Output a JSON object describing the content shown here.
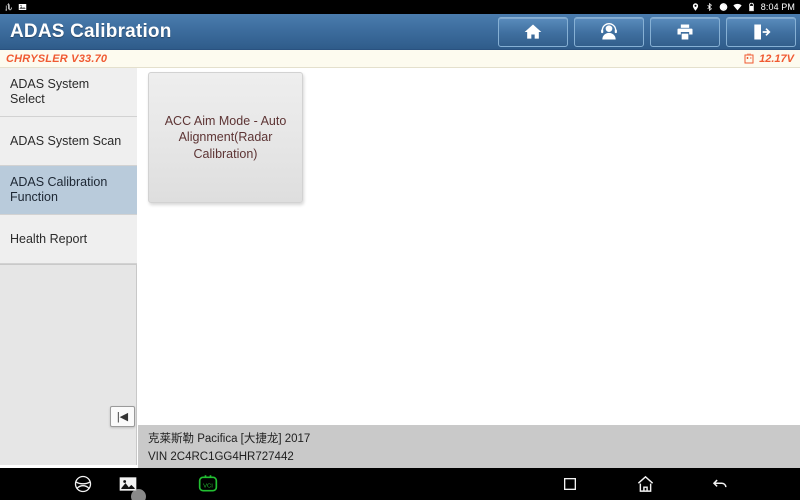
{
  "statusbar": {
    "left_icons": [
      "usb-icon",
      "screenshot-icon"
    ],
    "right_icons": [
      "location-icon",
      "bluetooth-icon",
      "sync-icon",
      "wifi-icon",
      "battery-icon"
    ],
    "time": "8:04 PM"
  },
  "titlebar": {
    "title": "ADAS Calibration",
    "actions": [
      {
        "name": "home-button",
        "icon": "home-icon"
      },
      {
        "name": "support-button",
        "icon": "headset-person-icon"
      },
      {
        "name": "print-button",
        "icon": "printer-icon"
      },
      {
        "name": "exit-button",
        "icon": "exit-door-icon"
      }
    ]
  },
  "versionbar": {
    "version": "CHRYSLER V33.70",
    "voltage": "12.17V",
    "accent_color": "#f05a32"
  },
  "sidebar": {
    "items": [
      {
        "label": "ADAS System Select",
        "active": false
      },
      {
        "label": "ADAS System Scan",
        "active": false
      },
      {
        "label": "ADAS Calibration Function",
        "active": true
      },
      {
        "label": "Health Report",
        "active": false
      }
    ],
    "collapse_glyph": "|◀",
    "active_color": "#b9cbdb"
  },
  "main": {
    "tiles": [
      {
        "label": "ACC Aim Mode - Auto Alignment(Radar Calibration)"
      }
    ],
    "tile_text_color": "#5d3434"
  },
  "vehicle": {
    "model": "克莱斯勒 Pacifica [大捷龙] 2017",
    "vin": "VIN 2C4RC1GG4HR727442"
  },
  "navbar": {
    "items": [
      {
        "name": "browser-button",
        "icon": "globe-icon"
      },
      {
        "name": "screenshot-button",
        "icon": "image-icon"
      },
      {
        "name": "vci-status-button",
        "icon": "vci-connector-icon",
        "color": "#22c032"
      },
      {
        "name": "recents-button",
        "icon": "square-icon"
      },
      {
        "name": "home-button",
        "icon": "home-outline-icon"
      },
      {
        "name": "back-button",
        "icon": "back-arrow-icon"
      }
    ]
  }
}
